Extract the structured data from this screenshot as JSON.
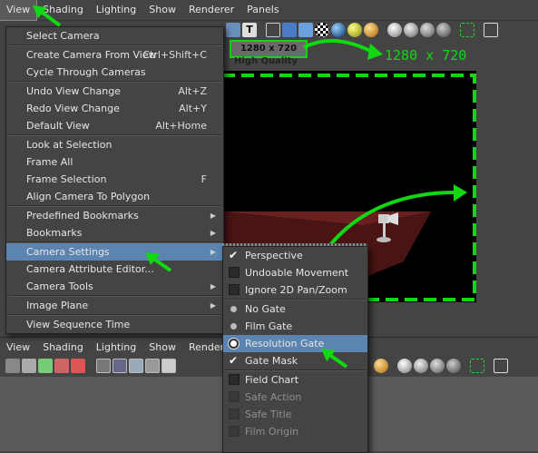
{
  "menubar_top": [
    "View",
    "Shading",
    "Lighting",
    "Show",
    "Renderer",
    "Panels"
  ],
  "menubar_bottom": [
    "View",
    "Shading",
    "Lighting",
    "Show",
    "Renderer",
    "Panels"
  ],
  "hud": {
    "resolution": "1280 x 720",
    "quality": "High Quality"
  },
  "annotation": {
    "resolution": "1280 x 720",
    "color": "#11d911"
  },
  "view_menu": [
    {
      "label": "Select Camera"
    },
    {
      "sep": true
    },
    {
      "label": "Create Camera From View",
      "shortcut": "Ctrl+Shift+C"
    },
    {
      "label": "Cycle Through Cameras"
    },
    {
      "sep": true
    },
    {
      "label": "Undo View Change",
      "shortcut": "Alt+Z"
    },
    {
      "label": "Redo View Change",
      "shortcut": "Alt+Y"
    },
    {
      "label": "Default View",
      "shortcut": "Alt+Home"
    },
    {
      "sep": true
    },
    {
      "label": "Look at Selection"
    },
    {
      "label": "Frame All"
    },
    {
      "label": "Frame Selection",
      "shortcut": "F"
    },
    {
      "label": "Align Camera To Polygon"
    },
    {
      "sep": true
    },
    {
      "label": "Predefined Bookmarks",
      "submenu": true
    },
    {
      "label": "Bookmarks",
      "submenu": true
    },
    {
      "sep": true
    },
    {
      "label": "Camera Settings",
      "submenu": true,
      "highlight": true
    },
    {
      "label": "Camera Attribute Editor..."
    },
    {
      "label": "Camera Tools",
      "submenu": true
    },
    {
      "sep": true
    },
    {
      "label": "Image Plane",
      "submenu": true
    },
    {
      "sep": true
    },
    {
      "label": "View Sequence Time"
    }
  ],
  "camera_settings_menu": [
    {
      "label": "Perspective",
      "kind": "check",
      "checked": true
    },
    {
      "label": "Undoable Movement",
      "kind": "check",
      "checked": false
    },
    {
      "label": "Ignore 2D Pan/Zoom",
      "kind": "check",
      "checked": false
    },
    {
      "sep": true
    },
    {
      "label": "No Gate",
      "kind": "radio",
      "selected": false
    },
    {
      "label": "Film Gate",
      "kind": "radio",
      "selected": false
    },
    {
      "label": "Resolution Gate",
      "kind": "radio",
      "selected": true,
      "highlight": true
    },
    {
      "label": "Gate Mask",
      "kind": "check",
      "checked": true
    },
    {
      "sep": true
    },
    {
      "label": "Field Chart",
      "kind": "check",
      "checked": false
    },
    {
      "label": "Safe Action",
      "kind": "check",
      "checked": false,
      "faded": true
    },
    {
      "label": "Safe Title",
      "kind": "check",
      "checked": false,
      "faded": true
    },
    {
      "label": "Film Origin",
      "kind": "check",
      "checked": false,
      "faded": true
    }
  ],
  "colors": {
    "menu_bg": "#444444",
    "highlight": "#5b84b1",
    "annotation_green": "#11d911",
    "viewport_bg": "#000000"
  },
  "icons": [
    "camera-icon",
    "sphere-icon",
    "cube-icon",
    "checker-icon",
    "light-icon",
    "bookmark-icon",
    "grid-icon"
  ]
}
